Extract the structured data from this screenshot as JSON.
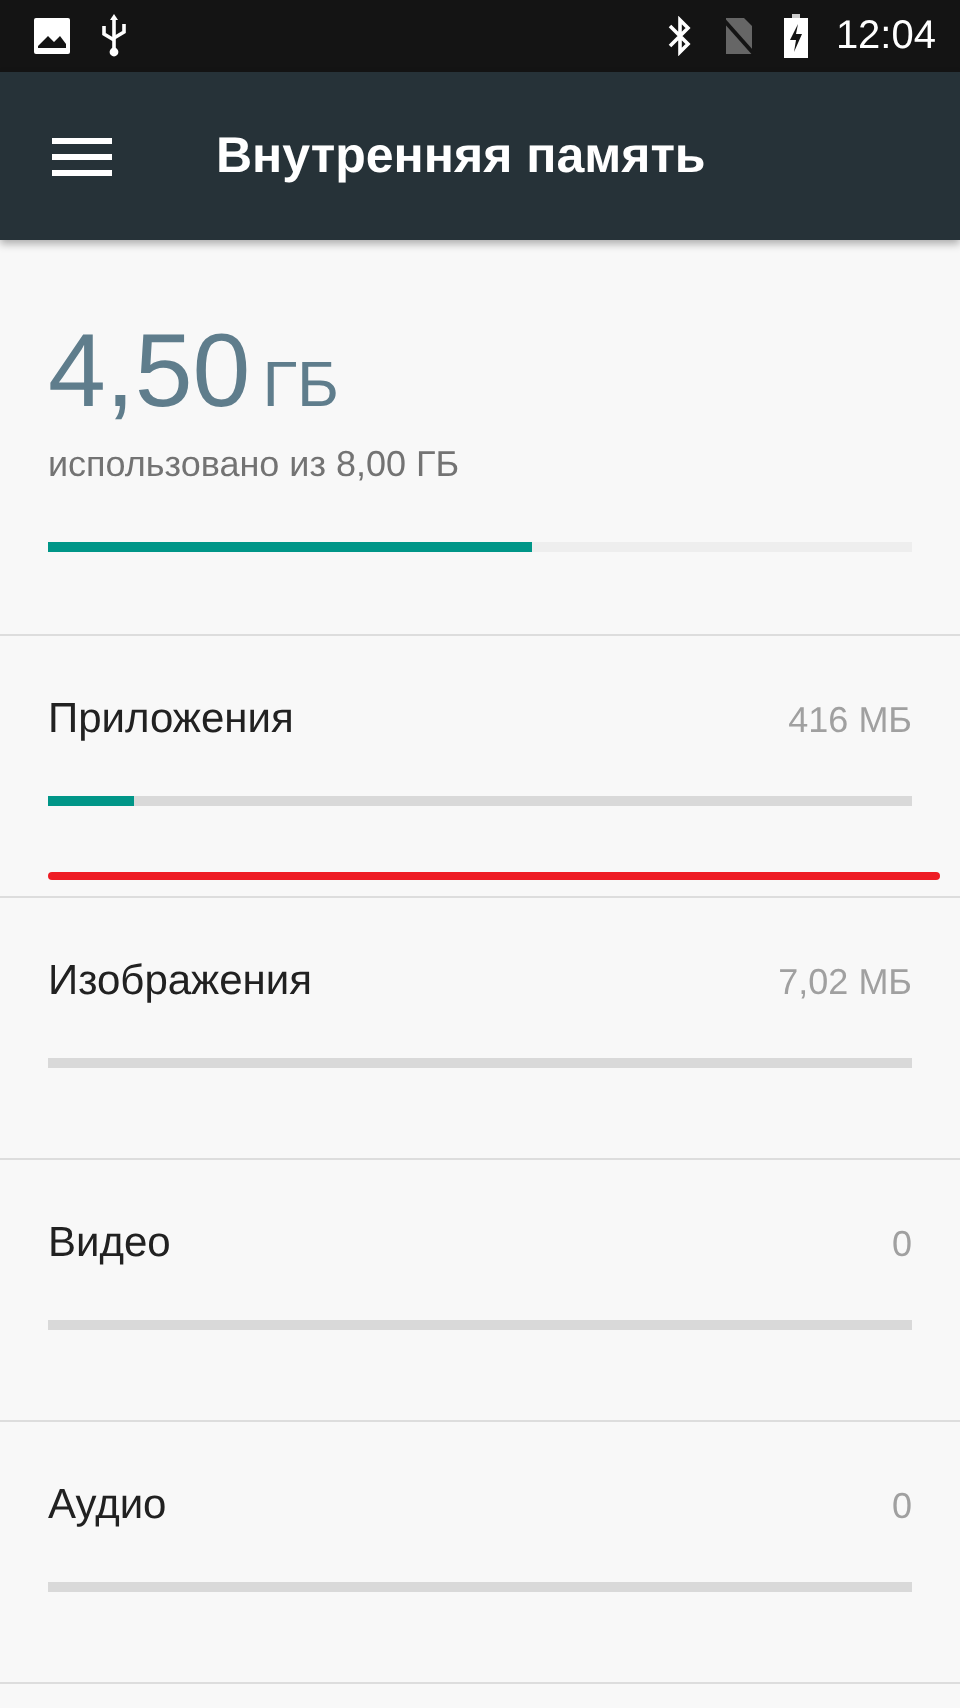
{
  "status_bar": {
    "time": "12:04"
  },
  "toolbar": {
    "title": "Внутренняя память"
  },
  "summary": {
    "used": "4,50",
    "unit": "ГБ",
    "caption": "использовано из 8,00 ГБ",
    "level": 0.56
  },
  "categories": [
    {
      "name": "Приложения",
      "size": "416 МБ",
      "level": 0.1,
      "highlighted": true
    },
    {
      "name": "Изображения",
      "size": "7,02 МБ",
      "highlighted": false
    },
    {
      "name": "Видео",
      "size": "0",
      "highlighted": false
    },
    {
      "name": "Аудио",
      "size": "0",
      "highlighted": false
    }
  ]
}
